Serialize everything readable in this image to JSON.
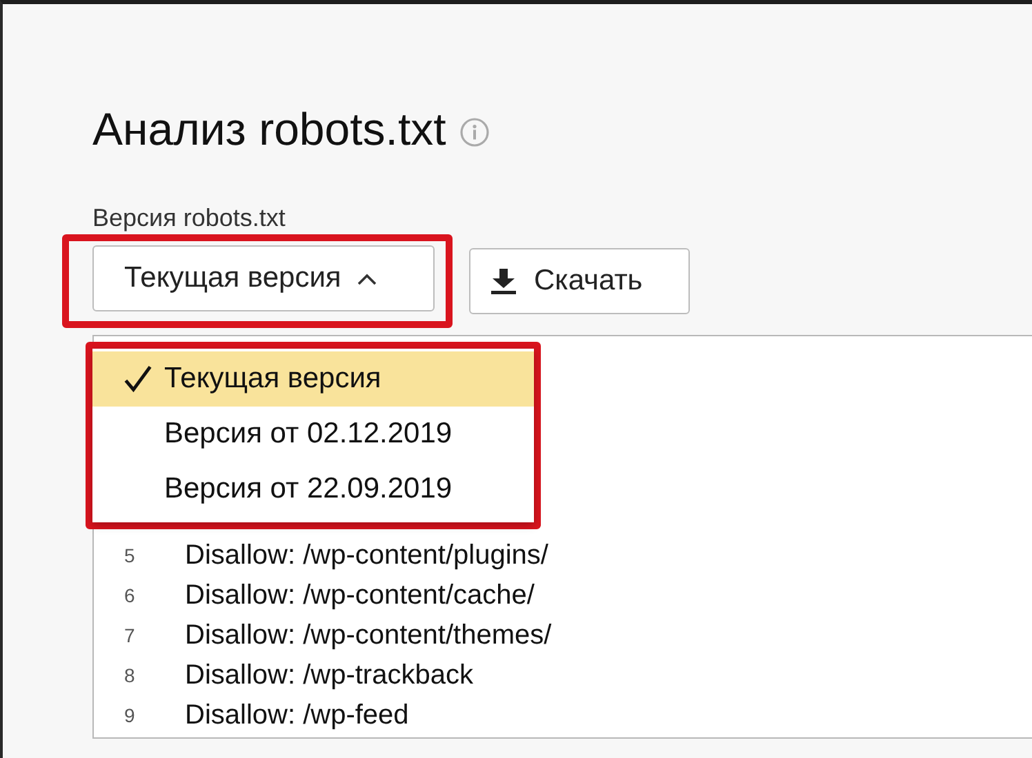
{
  "page": {
    "title": "Анализ robots.txt"
  },
  "version_label": "Версия robots.txt",
  "version_select": {
    "value": "Текущая версия",
    "expanded": true
  },
  "download_button": "Скачать",
  "version_menu": [
    {
      "label": "Текущая версия",
      "selected": true
    },
    {
      "label": "Версия от 02.12.2019",
      "selected": false
    },
    {
      "label": "Версия от 22.09.2019",
      "selected": false
    }
  ],
  "code_lines": [
    {
      "number": "5",
      "text": "Disallow: /wp-content/plugins/"
    },
    {
      "number": "6",
      "text": "Disallow: /wp-content/cache/"
    },
    {
      "number": "7",
      "text": "Disallow: /wp-content/themes/"
    },
    {
      "number": "8",
      "text": "Disallow: /wp-trackback"
    },
    {
      "number": "9",
      "text": "Disallow: /wp-feed"
    }
  ]
}
